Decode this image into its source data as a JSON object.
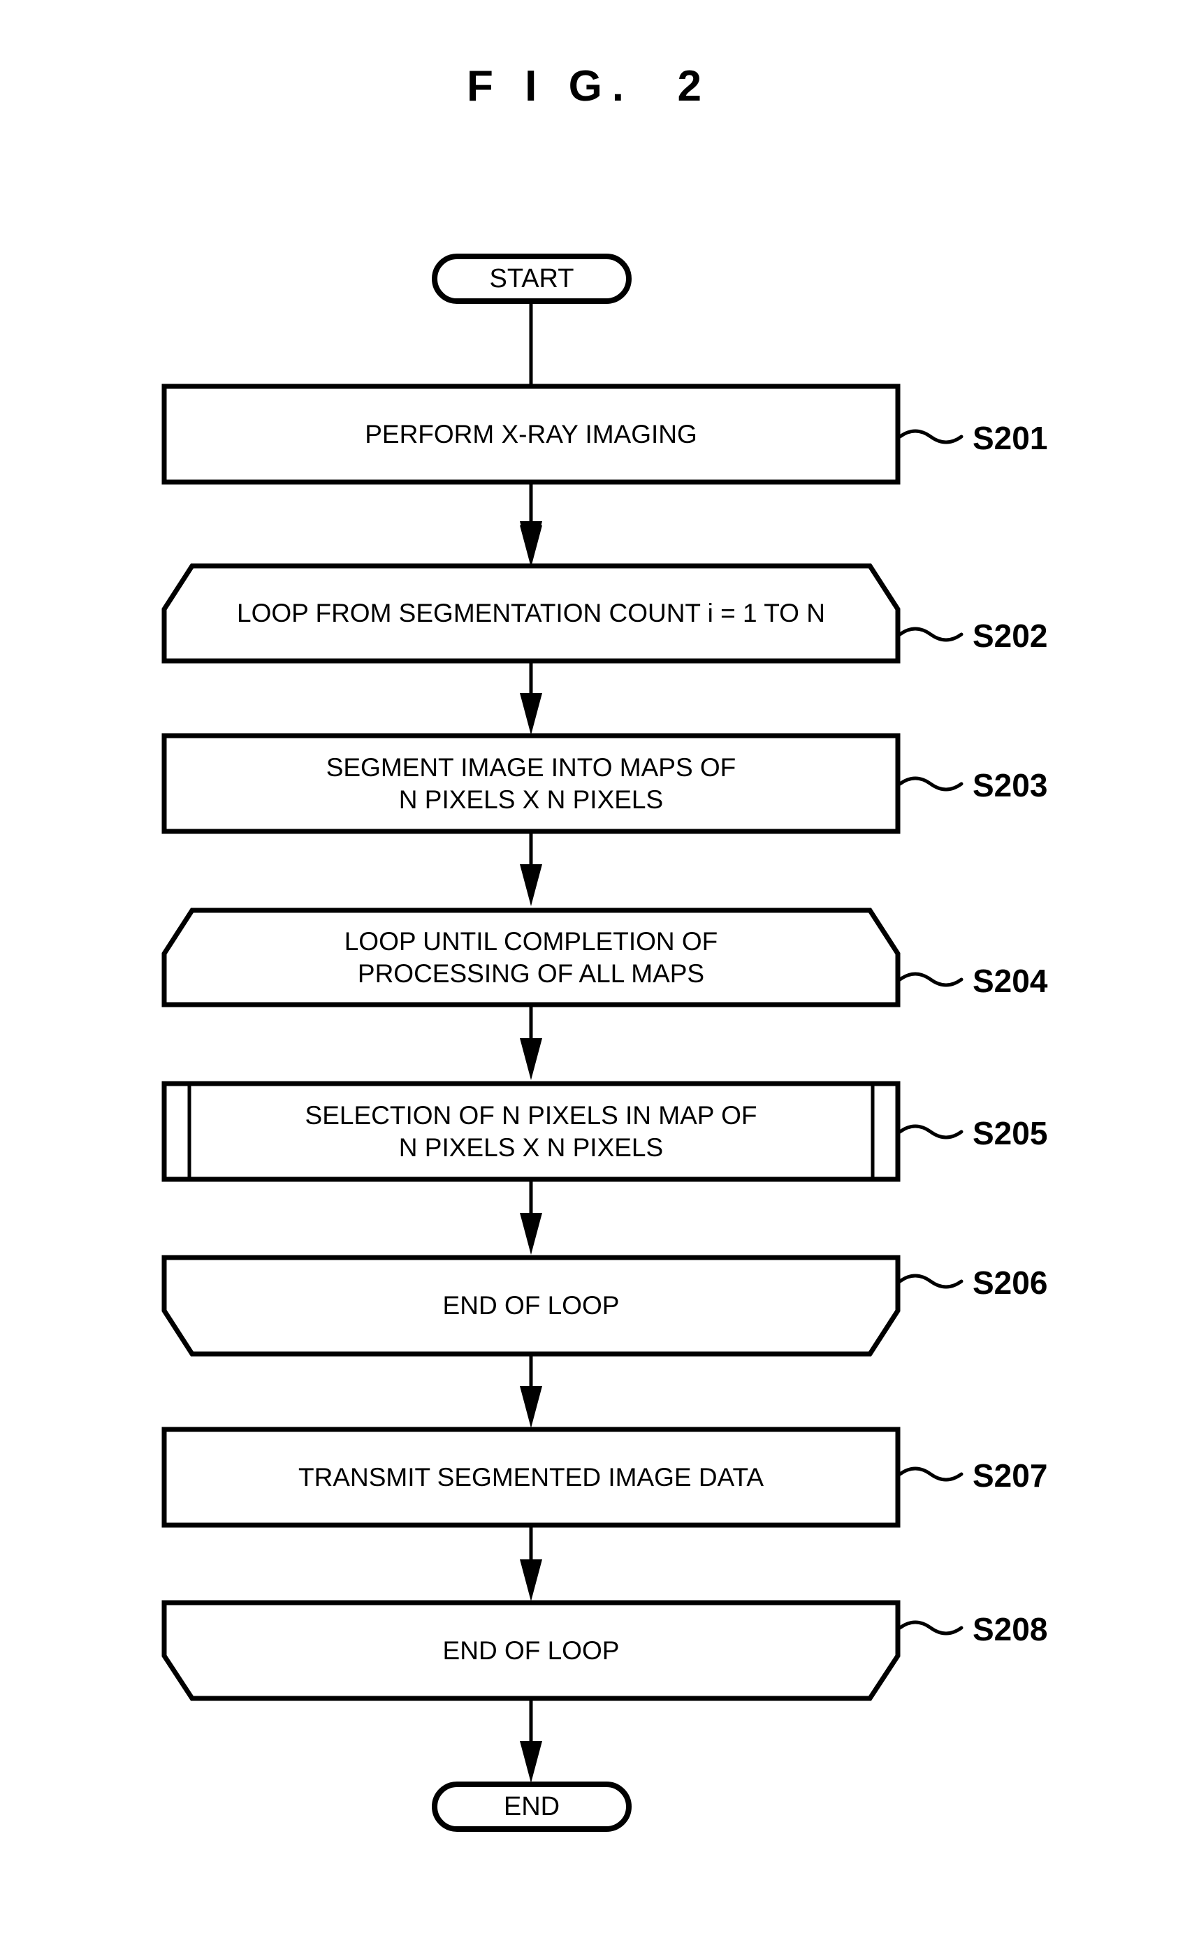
{
  "figure": {
    "title": "F I G.  2",
    "type": "flowchart",
    "background_color": "#ffffff",
    "line_color": "#000000"
  },
  "nodes": [
    {
      "id": "start",
      "shape": "terminal",
      "text": "START",
      "step_label": ""
    },
    {
      "id": "s201",
      "shape": "process",
      "text": "PERFORM X-RAY IMAGING",
      "step_label": "S201"
    },
    {
      "id": "s202",
      "shape": "loop-start",
      "text": "LOOP FROM SEGMENTATION COUNT i = 1 TO N",
      "step_label": "S202"
    },
    {
      "id": "s203",
      "shape": "process",
      "text": "SEGMENT IMAGE INTO MAPS OF\nN PIXELS X N PIXELS",
      "step_label": "S203"
    },
    {
      "id": "s204",
      "shape": "loop-start",
      "text": "LOOP UNTIL COMPLETION OF\nPROCESSING OF ALL MAPS",
      "step_label": "S204"
    },
    {
      "id": "s205",
      "shape": "predefined-process",
      "text": "SELECTION OF N PIXELS IN MAP OF\nN PIXELS X N PIXELS",
      "step_label": "S205"
    },
    {
      "id": "s206",
      "shape": "loop-end",
      "text": "END OF LOOP",
      "step_label": "S206"
    },
    {
      "id": "s207",
      "shape": "process",
      "text": "TRANSMIT SEGMENTED IMAGE DATA",
      "step_label": "S207"
    },
    {
      "id": "s208",
      "shape": "loop-end",
      "text": "END OF LOOP",
      "step_label": "S208"
    },
    {
      "id": "end",
      "shape": "terminal",
      "text": "END",
      "step_label": ""
    }
  ],
  "edges": [
    {
      "from": "start",
      "to": "s201"
    },
    {
      "from": "s201",
      "to": "s202"
    },
    {
      "from": "s202",
      "to": "s203"
    },
    {
      "from": "s203",
      "to": "s204"
    },
    {
      "from": "s204",
      "to": "s205"
    },
    {
      "from": "s205",
      "to": "s206"
    },
    {
      "from": "s206",
      "to": "s207"
    },
    {
      "from": "s207",
      "to": "s208"
    },
    {
      "from": "s208",
      "to": "end"
    }
  ]
}
